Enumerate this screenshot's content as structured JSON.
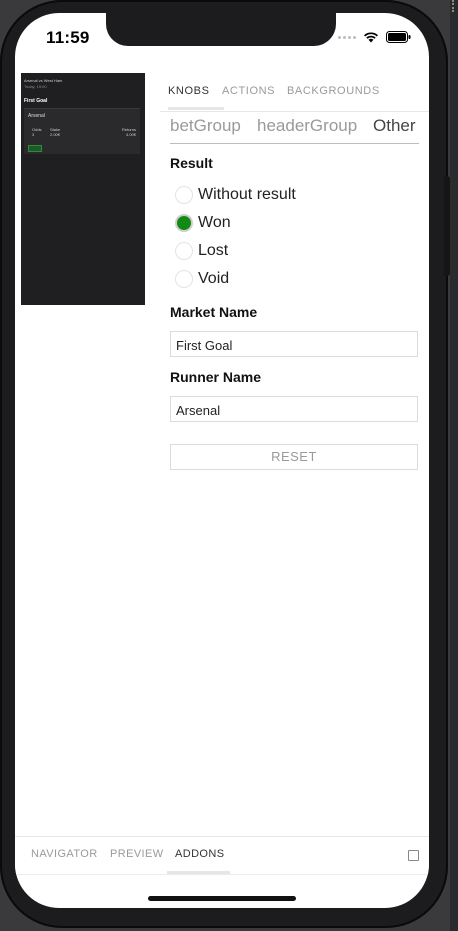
{
  "status": {
    "time": "11:59"
  },
  "preview": {
    "event": "Arsenal vs West Ham",
    "when": "Today, 15:00",
    "market": "First Goal",
    "runner": "Arsenal",
    "odds_label": "Odds",
    "odds_value": "3",
    "stake_label": "Stake",
    "stake_value": "2.00€",
    "returns_label": "Returns",
    "returns_value": "4.00€",
    "status_chip": "Won"
  },
  "addon_tabs": [
    {
      "label": "Knobs",
      "active": true
    },
    {
      "label": "Actions",
      "active": false
    },
    {
      "label": "Backgrounds",
      "active": false
    }
  ],
  "knob_groups": [
    {
      "label": "betGroup",
      "active": false
    },
    {
      "label": "headerGroup",
      "active": false
    },
    {
      "label": "Other",
      "active": true
    }
  ],
  "result": {
    "label": "Result",
    "options": [
      "Without result",
      "Won",
      "Lost",
      "Void"
    ],
    "selected": "Won",
    "selected_color": "#138a13"
  },
  "market_name": {
    "label": "Market Name",
    "value": "First Goal"
  },
  "runner_name": {
    "label": "Runner Name",
    "value": "Arsenal"
  },
  "reset_label": "Reset",
  "bottom_tabs": [
    {
      "label": "Navigator",
      "active": false
    },
    {
      "label": "Preview",
      "active": false
    },
    {
      "label": "Addons",
      "active": true
    }
  ]
}
